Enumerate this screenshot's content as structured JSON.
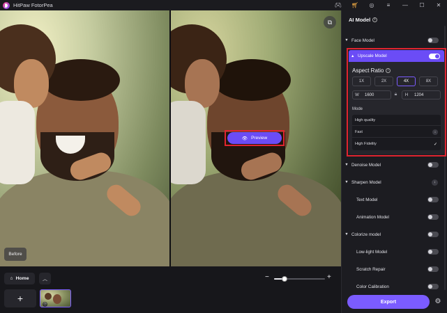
{
  "app": {
    "title": "HitPaw FotorPea"
  },
  "titlebar_icons": [
    "gamepad-icon",
    "cart-icon",
    "user-icon",
    "menu-icon",
    "minimize-icon",
    "maximize-icon",
    "close-icon"
  ],
  "canvas": {
    "before_label": "Before",
    "preview_label": "Preview"
  },
  "bottom": {
    "home_label": "Home",
    "add_symbol": "+",
    "zoom_minus": "−",
    "zoom_plus": "+",
    "zoom_level": 0.2
  },
  "panel": {
    "title": "AI Model",
    "items": [
      {
        "label": "Face Model",
        "toggle": false,
        "caret": true
      },
      {
        "label": "Denoise Model",
        "toggle": false,
        "caret": true
      },
      {
        "label": "Sharpen Model",
        "download": true,
        "caret": true
      },
      {
        "label": "Text Model",
        "toggle": false,
        "caret": false
      },
      {
        "label": "Animation Model",
        "toggle": false,
        "caret": false
      },
      {
        "label": "Colorize model",
        "toggle": false,
        "caret": true
      },
      {
        "label": "Low-light Model",
        "toggle": false,
        "caret": false
      },
      {
        "label": "Scratch Repair",
        "toggle": false,
        "caret": false
      },
      {
        "label": "Color Calibration",
        "toggle": false,
        "caret": false
      }
    ],
    "upscale": {
      "label": "Upscale Model",
      "enabled": true,
      "aspect_ratio_title": "Aspect Ratio",
      "scales": [
        "1X",
        "2X",
        "4X",
        "8X"
      ],
      "selected_scale": "4X",
      "width_key": "W",
      "width_value": "1600",
      "height_key": "H",
      "height_value": "1204",
      "mode_label": "Mode",
      "modes": [
        {
          "label": "High quality",
          "state": ""
        },
        {
          "label": "Fast",
          "state": "download"
        },
        {
          "label": "High Fidelity",
          "state": "selected"
        }
      ]
    },
    "export_label": "Export"
  },
  "colors": {
    "accent": "#7b5cff",
    "highlight": "#e0242f",
    "panel_bg": "#1c1c21"
  }
}
